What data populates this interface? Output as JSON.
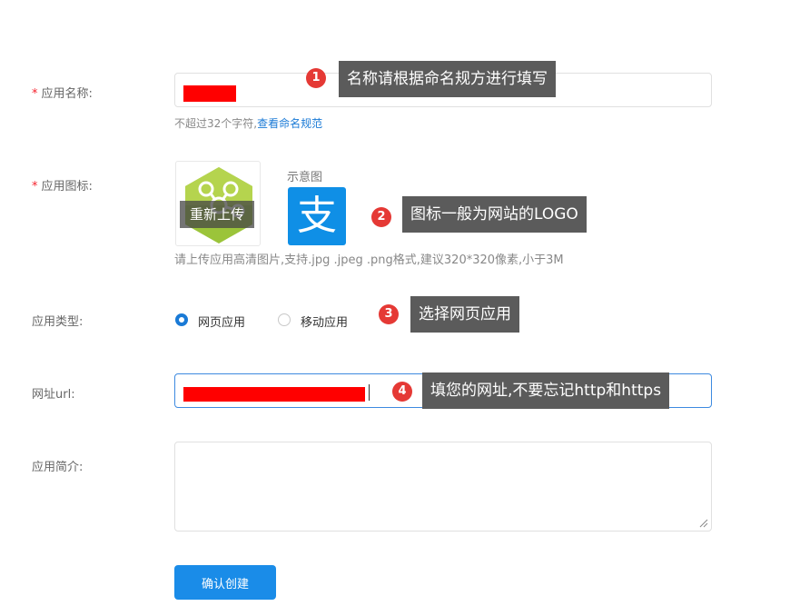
{
  "form": {
    "app_name": {
      "label": "应用名称:",
      "required_mark": "*",
      "hint_prefix": "不超过32个字符,",
      "hint_link": "查看命名规范"
    },
    "app_icon": {
      "label": "应用图标:",
      "required_mark": "*",
      "reupload_label": "重新上传",
      "example_label": "示意图",
      "example_glyph": "支",
      "hint": "请上传应用高清图片,支持.jpg .jpeg .png格式,建议320*320像素,小于3M"
    },
    "app_type": {
      "label": "应用类型:",
      "options": [
        "网页应用",
        "移动应用"
      ],
      "selected": "网页应用"
    },
    "url": {
      "label": "网址url:"
    },
    "intro": {
      "label": "应用简介:"
    },
    "submit_label": "确认创建"
  },
  "callouts": [
    {
      "num": "1",
      "text": "名称请根据命名规方进行填写"
    },
    {
      "num": "2",
      "text": "图标一般为网站的LOGO"
    },
    {
      "num": "3",
      "text": "选择网页应用"
    },
    {
      "num": "4",
      "text": "填您的网址,不要忘记http和https"
    }
  ],
  "colors": {
    "primary": "#1a8ce8",
    "link": "#1a7ad6",
    "required": "#f5222d",
    "callout_bg": "#5b5b5b",
    "badge": "#e53935",
    "redaction": "#ff0000"
  }
}
